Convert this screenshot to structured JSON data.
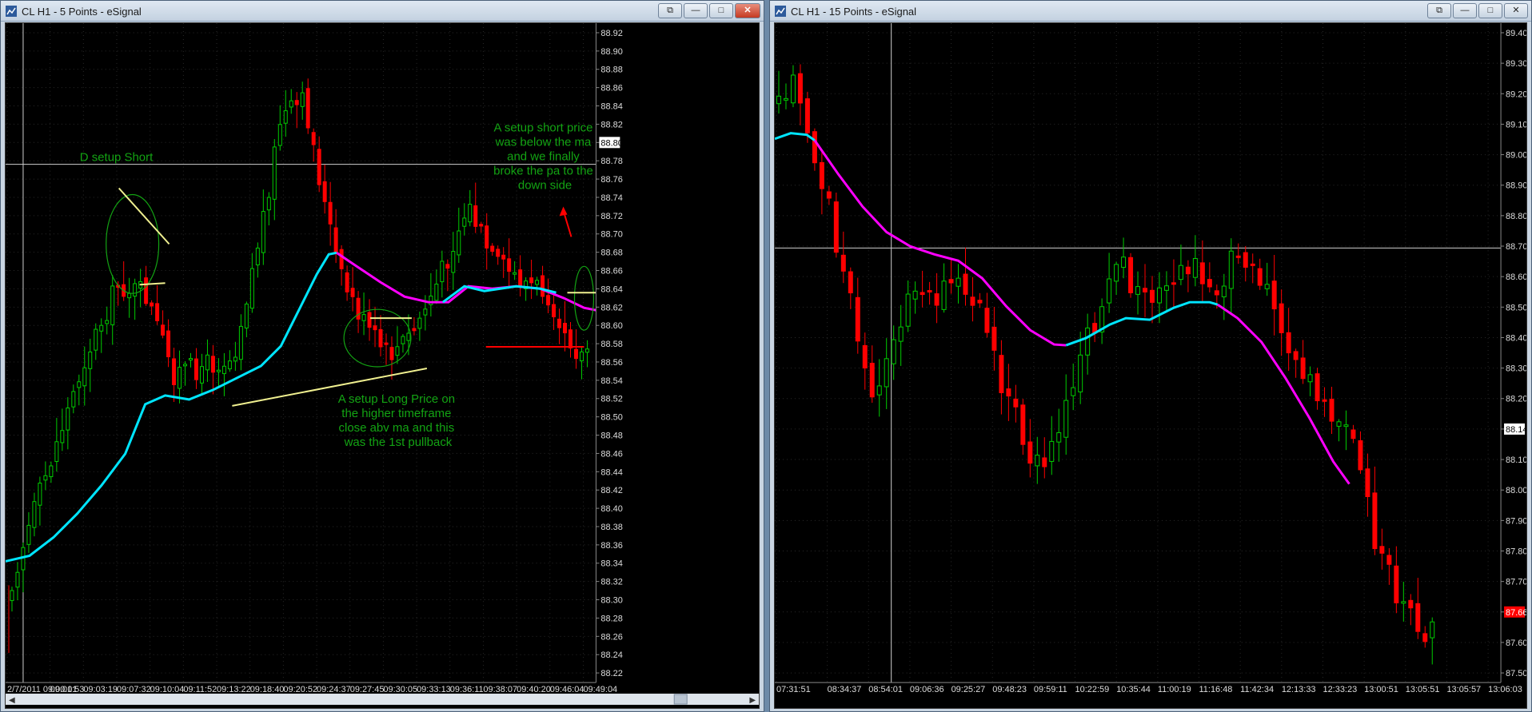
{
  "left_window": {
    "title": "CL H1 - 5 Points - eSignal",
    "buttons": {
      "pin": "⧉",
      "minimize": "—",
      "maximize": "□",
      "close": "✕"
    },
    "price_axis": [
      "88.92",
      "88.90",
      "88.88",
      "88.86",
      "88.84",
      "88.82",
      "88.80",
      "88.78",
      "88.76",
      "88.74",
      "88.72",
      "88.70",
      "88.68",
      "88.66",
      "88.64",
      "88.62",
      "88.60",
      "88.58",
      "88.56",
      "88.54",
      "88.52",
      "88.50",
      "88.48",
      "88.46",
      "88.44",
      "88.42",
      "88.40",
      "88.38",
      "88.36",
      "88.34",
      "88.32",
      "88.30",
      "88.28",
      "88.26",
      "88.24",
      "88.22"
    ],
    "current_price": "88.80",
    "time_axis": [
      "2/7/2011 09:00:01",
      "09:01:53",
      "09:03:19",
      "09:07:32",
      "09:10:04",
      "09:11:52",
      "09:13:22",
      "09:18:40",
      "09:20:52",
      "09:24:37",
      "09:27:45",
      "09:30:05",
      "09:33:13",
      "09:36:11",
      "09:38:07",
      "09:40:20",
      "09:46:04",
      "09:49:04"
    ],
    "annotations": {
      "d_setup": "D setup Short",
      "a_short": [
        "A setup short price",
        "was below the ma",
        "and we finally",
        "broke the pa to the",
        "down side"
      ],
      "a_long": [
        "A setup Long Price on",
        "the higher timeframe",
        "close abv ma and this",
        "was the 1st pullback"
      ]
    }
  },
  "right_window": {
    "title": "CL H1 - 15 Points - eSignal",
    "buttons": {
      "pin": "⧉",
      "minimize": "—",
      "maximize": "□",
      "close": "✕"
    },
    "price_axis": [
      "89.40",
      "89.30",
      "89.20",
      "89.10",
      "89.00",
      "88.90",
      "88.80",
      "88.70",
      "88.60",
      "88.50",
      "88.40",
      "88.30",
      "88.20",
      "88.14",
      "88.10",
      "88.00",
      "87.90",
      "87.80",
      "87.70",
      "87.66",
      "87.60",
      "87.50"
    ],
    "current_price": "88.14",
    "last_price": "87.66",
    "time_axis": [
      "07:31:51",
      "08:34:37",
      "08:54:01",
      "09:06:36",
      "09:25:27",
      "09:48:23",
      "09:59:11",
      "10:22:59",
      "10:35:44",
      "11:00:19",
      "11:16:48",
      "11:42:34",
      "12:13:33",
      "12:33:23",
      "13:00:51",
      "13:05:51",
      "13:05:57",
      "13:06:03"
    ]
  },
  "colors": {
    "up": "#00cc00",
    "down": "#ff0000",
    "ma_up": "#00e5ff",
    "ma_down": "#ff00ff",
    "annotation": "#13a313",
    "line": "#f0f090"
  }
}
